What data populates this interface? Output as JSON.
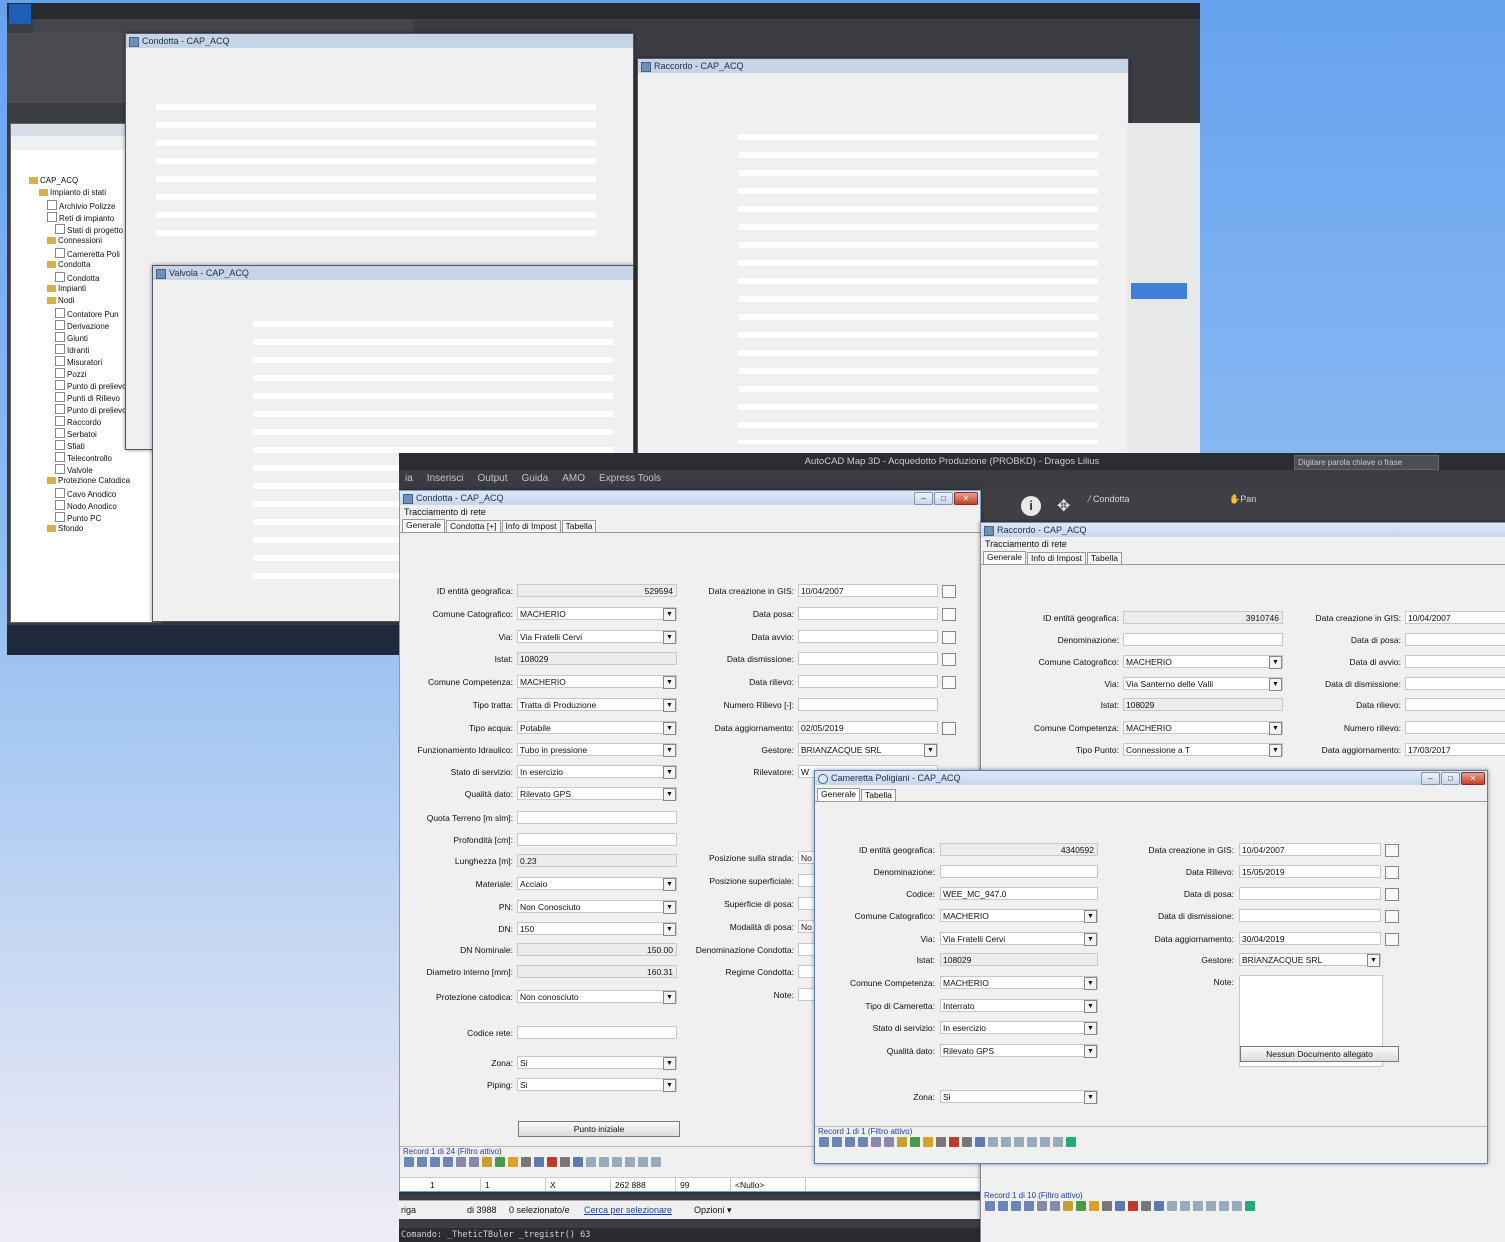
{
  "main": {
    "app_title": "AutoCAD Map 3D - Acquedotto Produzione (PROBKD) - Dragos Lilius",
    "menu": [
      "ia",
      "Inserisci",
      "Output",
      "Guida",
      "AMO",
      "Express Tools"
    ],
    "search_placeholder": "Digitare parola chiave o frase",
    "ribbon": {
      "condotta_btn": "Condotta",
      "pan_btn": "Pan"
    },
    "condotta": {
      "title": "Condotta - CAP_ACQ",
      "subtitle": "Tracciamento di rete",
      "tabs": [
        "Generale",
        "Condotta [+]",
        "Info di Impost",
        "Tabella"
      ],
      "left_labels": [
        "ID entità geografica:",
        "Comune Catografico:",
        "Via:",
        "Istat:",
        "Comune Competenza:",
        "Tipo tratta:",
        "Tipo acqua:",
        "Funzionamento Idraulico:",
        "Stato di servizio:",
        "Qualità dato:",
        "Quota Terreno [m slm]:",
        "Profondità [cm]:",
        "Lunghezza [m]:",
        "Materiale:",
        "PN:",
        "DN:",
        "DN Nominale:",
        "Diametro interno [mm]:",
        "Protezione catodica:",
        "Codice rete:",
        "Zona:",
        "Piping:"
      ],
      "left_values": [
        "529594",
        "MACHERIO",
        "Via Fratelli Cervi",
        "108029",
        "MACHERIO",
        "Tratta di Produzione",
        "Potabile",
        "Tubo in pressione",
        "In esercizio",
        "Rilevato GPS",
        "",
        "",
        "0.23",
        "Acciaio",
        "Non Conosciuto",
        "150",
        "150.00",
        "160.31",
        "Non conosciuto",
        "",
        "Si",
        "Si"
      ],
      "right_labels": [
        "Data creazione in GIS:",
        "Data posa:",
        "Data avvio:",
        "Data dismissione:",
        "Data rilievo:",
        "Numero Rilievo [-]:",
        "Data aggiornamento:",
        "Gestore:",
        "Rilevatore:",
        "Posizione sulla strada:",
        "Posizione superficiale:",
        "Superficie di posa:",
        "Modalità di posa:",
        "Denominazione Condotta:",
        "Regime Condotta:",
        "Note:"
      ],
      "right_values": [
        "10/04/2007",
        "",
        "",
        "",
        "",
        "",
        "02/05/2019",
        "BRIANZACQUE SRL",
        "W",
        "No",
        "",
        "",
        "No",
        "",
        "",
        ""
      ],
      "punto_iniziale_btn": "Punto iniziale",
      "record_text": "Record 1 di 24 (Filtro attivo)"
    },
    "raccordo": {
      "title": "Raccordo - CAP_ACQ",
      "subtitle": "Tracciamento di rete",
      "tabs": [
        "Generale",
        "Info di Impost",
        "Tabella"
      ],
      "left_labels": [
        "ID entità geografica:",
        "Denominazione:",
        "Comune Catografico:",
        "Via:",
        "Istat:",
        "Comune Competenza:",
        "Tipo Punto:"
      ],
      "left_values": [
        "3910746",
        "",
        "MACHERIO",
        "Via Santerno delle Valli",
        "108029",
        "MACHERIO",
        "Connessione a T"
      ],
      "right_labels": [
        "Data creazione in GIS:",
        "Data di posa:",
        "Data di avvio:",
        "Data di dismissione:",
        "Data rilievo:",
        "Numero rilievo:",
        "Data aggiornamento:"
      ],
      "right_values": [
        "10/04/2007",
        "",
        "",
        "",
        "",
        "",
        "17/03/2017"
      ],
      "record_text": "Record 1 di 10 (Filtro attivo)"
    },
    "cameretta": {
      "title": "Cameretta Poligiani - CAP_ACQ",
      "tabs": [
        "Generale",
        "Tabella"
      ],
      "left_labels": [
        "ID entità geografica:",
        "Denominazione:",
        "Codice:",
        "Comune Catografico:",
        "Via:",
        "Istat:",
        "Comune Competenza:",
        "Tipo di Cameretta:",
        "Stato di servizio:",
        "Qualità dato:"
      ],
      "left_values": [
        "4340592",
        "",
        "WEE_MC_947.0",
        "MACHERIO",
        "Via Fratelli Cervi",
        "108029",
        "MACHERIO",
        "Interrato",
        "In esercizio",
        "Rilevato GPS"
      ],
      "right_labels": [
        "Data creazione in GIS:",
        "Data Rilievo:",
        "Data di posa:",
        "Data di dismissione:",
        "Data aggiornamento:",
        "Gestore:",
        "Note:"
      ],
      "right_values": [
        "10/04/2007",
        "15/05/2019",
        "",
        "",
        "30/04/2019",
        "BRIANZACQUE SRL",
        ""
      ],
      "zona_label": "Zona:",
      "zona_value": "Si",
      "doc_btn": "Nessun Documento allegato",
      "record_text": "Record 1 di 1 (Filtro attivo)"
    },
    "grid_row": [
      "1",
      "1",
      "X",
      "262 888",
      "99",
      "<Nullo>"
    ],
    "status": {
      "riga": "riga",
      "count": "di 3988",
      "selected": "0 selezionato/e",
      "select_link": "Cerca per selezionare",
      "options": "Opzioni"
    },
    "command": "Comando: _TheticTBuler _tregistr() 63"
  },
  "colors": {
    "accent": "#2b5fc1",
    "desktop_top": "#67a2ef",
    "autocad_dark": "#2e3035"
  }
}
